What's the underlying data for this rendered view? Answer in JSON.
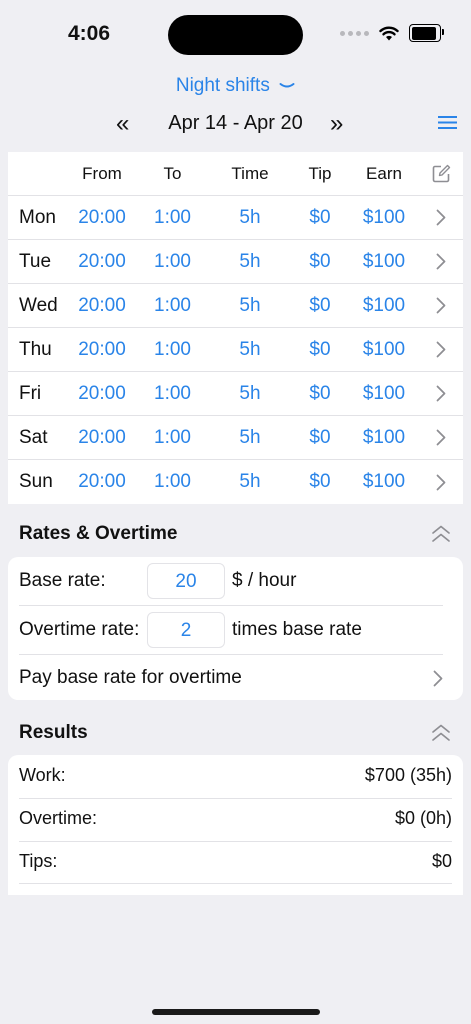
{
  "status": {
    "time": "4:06"
  },
  "header": {
    "preset_label": "Night shifts",
    "prev_symbol": "«",
    "week_range": "Apr 14 - Apr 20",
    "next_symbol": "»"
  },
  "table": {
    "headers": [
      "From",
      "To",
      "Time",
      "Tip",
      "Earn"
    ],
    "rows": [
      {
        "day": "Mon",
        "from": "20:00",
        "to": "1:00",
        "time": "5h",
        "tip": "$0",
        "earn": "$100"
      },
      {
        "day": "Tue",
        "from": "20:00",
        "to": "1:00",
        "time": "5h",
        "tip": "$0",
        "earn": "$100"
      },
      {
        "day": "Wed",
        "from": "20:00",
        "to": "1:00",
        "time": "5h",
        "tip": "$0",
        "earn": "$100"
      },
      {
        "day": "Thu",
        "from": "20:00",
        "to": "1:00",
        "time": "5h",
        "tip": "$0",
        "earn": "$100"
      },
      {
        "day": "Fri",
        "from": "20:00",
        "to": "1:00",
        "time": "5h",
        "tip": "$0",
        "earn": "$100"
      },
      {
        "day": "Sat",
        "from": "20:00",
        "to": "1:00",
        "time": "5h",
        "tip": "$0",
        "earn": "$100"
      },
      {
        "day": "Sun",
        "from": "20:00",
        "to": "1:00",
        "time": "5h",
        "tip": "$0",
        "earn": "$100"
      }
    ]
  },
  "rates": {
    "title": "Rates & Overtime",
    "base_label": "Base rate:",
    "base_value": "20",
    "base_unit": "$ / hour",
    "overtime_label": "Overtime rate:",
    "overtime_value": "2",
    "overtime_unit": "times base rate",
    "pay_base_label": "Pay base rate for overtime"
  },
  "results": {
    "title": "Results",
    "work_label": "Work:",
    "work_value": "$700 (35h)",
    "overtime_label": "Overtime:",
    "overtime_value": "$0 (0h)",
    "tips_label": "Tips:",
    "tips_value": "$0"
  },
  "colors": {
    "accent": "#2a84e8",
    "background": "#efeff3",
    "card": "#ffffff"
  }
}
